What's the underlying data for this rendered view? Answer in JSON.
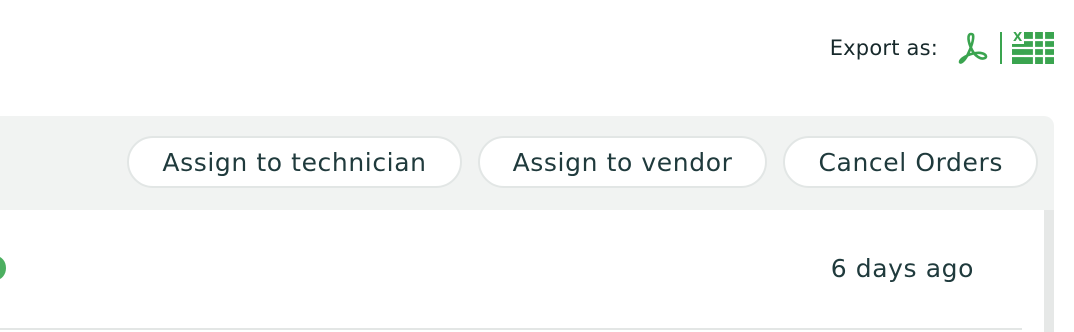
{
  "export": {
    "label": "Export as:",
    "pdf_icon": "pdf-icon",
    "excel_icon": "excel-icon"
  },
  "toolbar": {
    "buttons": [
      {
        "label": "Assign to technician"
      },
      {
        "label": "Assign to vendor"
      },
      {
        "label": "Cancel Orders"
      }
    ]
  },
  "rows": [
    {
      "status": "active",
      "time": "6 days ago"
    }
  ],
  "colors": {
    "accent": "#3aa44f",
    "status_dot": "#4caf60",
    "toolbar_bg": "#f1f3f2",
    "text": "#1f3a3c"
  }
}
